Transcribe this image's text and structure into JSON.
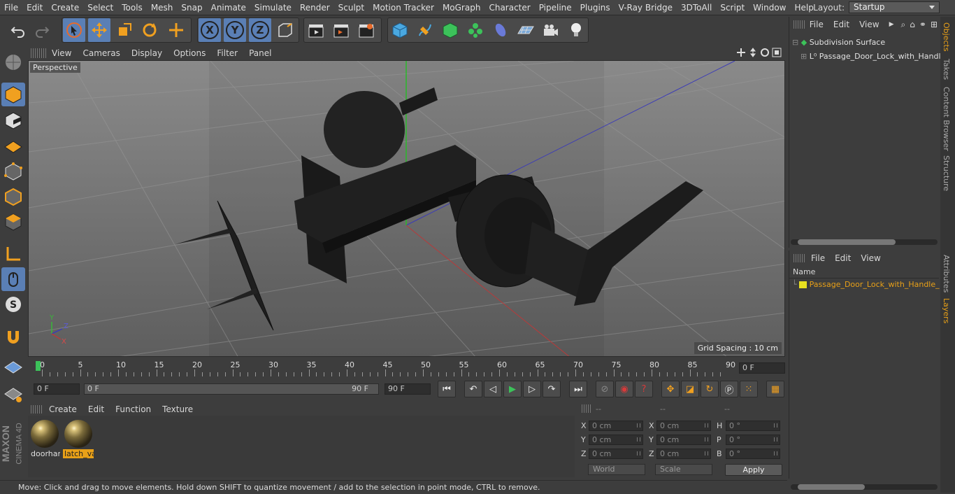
{
  "menubar": {
    "items": [
      "File",
      "Edit",
      "Create",
      "Select",
      "Tools",
      "Mesh",
      "Snap",
      "Animate",
      "Simulate",
      "Render",
      "Sculpt",
      "Motion Tracker",
      "MoGraph",
      "Character",
      "Pipeline",
      "Plugins",
      "V-Ray Bridge",
      "3DToAll",
      "Script",
      "Window",
      "Help"
    ],
    "layout_label": "Layout:",
    "layout_value": "Startup"
  },
  "toolbar": {
    "axis_x": "X",
    "axis_y": "Y",
    "axis_z": "Z"
  },
  "viewport": {
    "menu": [
      "View",
      "Cameras",
      "Display",
      "Options",
      "Filter",
      "Panel"
    ],
    "camera_label": "Perspective",
    "grid_spacing": "Grid Spacing : 10 cm",
    "gizmo": {
      "x": "X",
      "y": "Y",
      "z": "Z"
    }
  },
  "timeline": {
    "ticks": [
      "0",
      "5",
      "10",
      "15",
      "20",
      "25",
      "30",
      "35",
      "40",
      "45",
      "50",
      "55",
      "60",
      "65",
      "70",
      "75",
      "80",
      "85",
      "90"
    ],
    "current_frame": "0 F"
  },
  "transport": {
    "start_field": "0 F",
    "range_start": "0 F",
    "range_end": "90 F",
    "end_field": "90 F"
  },
  "material_manager": {
    "menu": [
      "Create",
      "Edit",
      "Function",
      "Texture"
    ],
    "materials": [
      {
        "name": "doorhar",
        "selected": false
      },
      {
        "name": "latch_va",
        "selected": true
      }
    ]
  },
  "coordinates": {
    "headers": [
      "--",
      "--",
      "--"
    ],
    "rows": [
      {
        "l1": "X",
        "v1": "0 cm",
        "l2": "X",
        "v2": "0 cm",
        "l3": "H",
        "v3": "0 °"
      },
      {
        "l1": "Y",
        "v1": "0 cm",
        "l2": "Y",
        "v2": "0 cm",
        "l3": "P",
        "v3": "0 °"
      },
      {
        "l1": "Z",
        "v1": "0 cm",
        "l2": "Z",
        "v2": "0 cm",
        "l3": "B",
        "v3": "0 °"
      }
    ],
    "world_dropdown": "World",
    "scale_dropdown": "Scale",
    "apply": "Apply"
  },
  "status": "Move: Click and drag to move elements. Hold down SHIFT to quantize movement / add to the selection in point mode, CTRL to remove.",
  "object_manager": {
    "menu": [
      "File",
      "Edit",
      "View"
    ],
    "objects": [
      "Subdivision Surface",
      "Passage_Door_Lock_with_Handle"
    ]
  },
  "layer_manager": {
    "menu": [
      "File",
      "Edit",
      "View"
    ],
    "column": "Name",
    "layers": [
      "Passage_Door_Lock_with_Handle_"
    ]
  },
  "side_tabs": [
    "Objects",
    "Takes",
    "Content Browser",
    "Structure",
    "Attributes",
    "Layers"
  ],
  "brand": {
    "maxon": "MAXON",
    "product": "CINEMA 4D"
  },
  "colors": {
    "accent": "#e8a018",
    "active_blue": "#5a7fb5"
  }
}
